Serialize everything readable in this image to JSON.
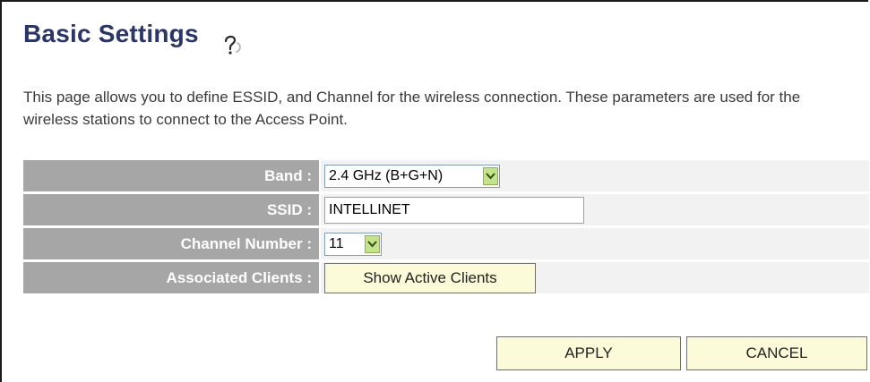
{
  "page": {
    "title": "Basic Settings",
    "help_icon": "help-icon",
    "description": "This page allows you to define ESSID, and Channel for the wireless connection. These parameters are used for the wireless stations to connect to the Access Point."
  },
  "form": {
    "band": {
      "label": "Band :",
      "value": "2.4 GHz (B+G+N)"
    },
    "ssid": {
      "label": "SSID :",
      "value": "INTELLINET"
    },
    "channel": {
      "label": "Channel Number :",
      "value": "11"
    },
    "clients": {
      "label": "Associated Clients :",
      "button": "Show Active Clients"
    }
  },
  "actions": {
    "apply": "APPLY",
    "cancel": "CANCEL"
  },
  "colors": {
    "title": "#2b3566",
    "label_bg": "#a6a6a6",
    "button_bg": "#fbfbd9",
    "select_arrow": "#c4e38c"
  }
}
